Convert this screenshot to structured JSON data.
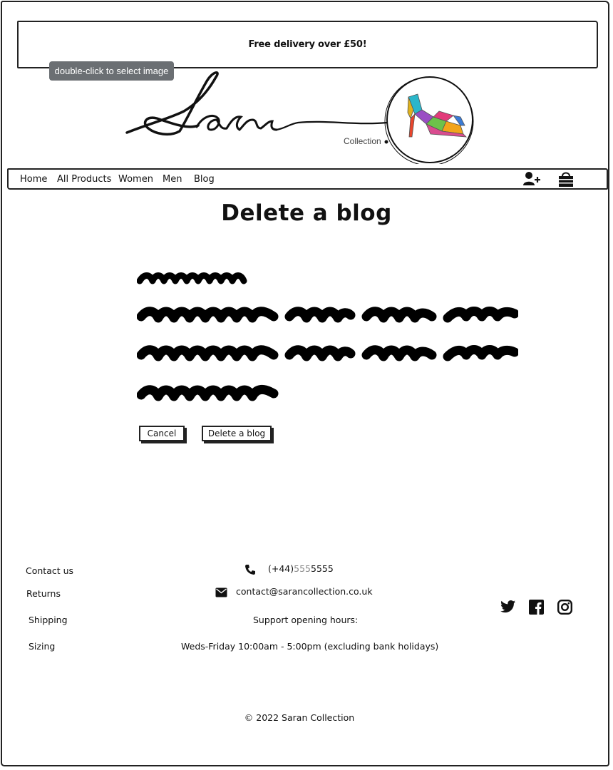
{
  "banner": {
    "promo_text": "Free delivery over £50!"
  },
  "tooltip": {
    "text": "double-click to select image"
  },
  "logo": {
    "script_text": "Saran",
    "sub_text": "Collection"
  },
  "nav": {
    "items": [
      "Home",
      "All Products",
      "Women",
      "Men",
      "Blog"
    ],
    "icons": [
      "add-user-icon",
      "shopping-bag-icon"
    ]
  },
  "page": {
    "title": "Delete a blog"
  },
  "form": {
    "cancel_label": "Cancel",
    "submit_label": "Delete a blog"
  },
  "footer": {
    "links": [
      "Contact us",
      "Returns",
      "Shipping",
      "Sizing"
    ],
    "phone_prefix": "(+44)",
    "phone_muted": "555",
    "phone_suffix": "5555",
    "email": "contact@sarancollection.co.uk",
    "hours_title": "Support opening hours:",
    "hours": "Weds-Friday 10:00am - 5:00pm (excluding bank holidays)",
    "social_icons": [
      "twitter-icon",
      "facebook-icon",
      "instagram-icon"
    ],
    "copyright": "© 2022 Saran Collection"
  },
  "colors": {
    "ink": "#111111",
    "tooltip_bg": "#6b6f73",
    "muted": "#8a8a8a"
  }
}
